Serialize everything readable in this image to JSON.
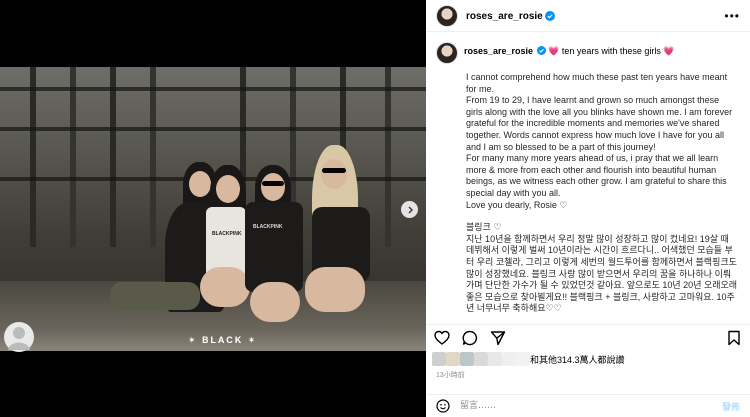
{
  "post": {
    "username": "roses_are_rosie",
    "caption_title": "ten years with these girls",
    "caption_paragraphs": [
      "I cannot comprehend how much these past ten years have meant for me.",
      "From 19 to 29, I have learnt and grown so much amongst these girls along with the love all you blinks have shown me. I am forever grateful for the incredible moments and memories we've shared together. Words cannot express how much love I have for you all and I am so blessed to be a part of this journey!",
      "For many many more years ahead of us, i pray that we all learn more & more from each other and flourish into beautiful human beings, as we witness each other grow. I am grateful to share this special day with you all.",
      "Love you dearly, Rosie ♡",
      "",
      "블링크 ♡",
      "지난 10년을 함께하면서 우리 정말 많이 성장하고 많이 컸네요! 19살 때 데뷔해서 이렇게 벌써 10년이라는 시간이 흐르다니.. 어색했던 모습들 부터 우리 코첼라, 그리고 이렇게 세번의 월드투어를 함께하면서 블랙핑크도 많이 성장했네요. 블링크 사랑 많이 받으면서 우리의 꿈을 하나하나 이뤄가며 단단한 가수가 될 수 있었던것 같아요. 앞으로도 10년 20년 오래오래 좋은 모습으로 찾아뵐게요!! 블랙핑크 + 블링크, 사랑하고 고마워요. 10주년 너무너무 축하해요♡♡"
    ],
    "likes_text": "和其他314.3萬人都說讚",
    "time_ago": "13小時前",
    "comment_placeholder": "留言……",
    "post_label": "發佈",
    "photo_caption_dots": "✶ 𝐁𝐋𝐀𝐂𝐊 ✶",
    "shirt_text_1": "BLACKPINK",
    "shirt_text_2": "BLACKPINK"
  },
  "icons": {
    "verified": "verified-badge-icon",
    "more": "more-options-icon",
    "like": "heart-icon",
    "comment": "comment-icon",
    "share": "share-icon",
    "save": "bookmark-icon",
    "emoji": "emoji-icon",
    "next": "chevron-right-icon"
  },
  "colors": {
    "verified": "#0095f6",
    "heart_emoji": "#e8338a",
    "post_button": "#b2dffc",
    "muted": "#8e8e8e"
  }
}
